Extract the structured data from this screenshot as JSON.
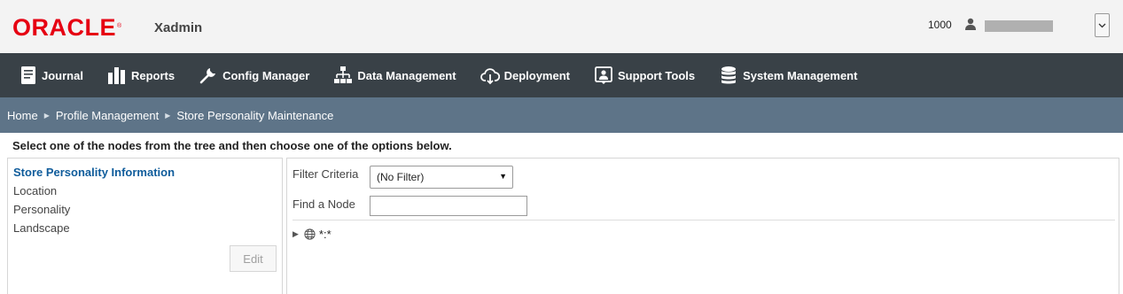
{
  "header": {
    "logo": "ORACLE",
    "logo_mark": "®",
    "app_name": "Xadmin",
    "store_number": "1000"
  },
  "nav": {
    "items": [
      {
        "label": "Journal",
        "icon": "journal-icon"
      },
      {
        "label": "Reports",
        "icon": "reports-icon"
      },
      {
        "label": "Config Manager",
        "icon": "wrench-icon"
      },
      {
        "label": "Data Management",
        "icon": "hierarchy-icon"
      },
      {
        "label": "Deployment",
        "icon": "cloud-download-icon"
      },
      {
        "label": "Support Tools",
        "icon": "support-icon"
      },
      {
        "label": "System Management",
        "icon": "database-icon"
      }
    ]
  },
  "breadcrumb": {
    "items": [
      "Home",
      "Profile Management",
      "Store Personality Maintenance"
    ]
  },
  "instructions": "Select one of the nodes from the tree and then choose one of the options below.",
  "left_panel": {
    "items": [
      "Store Personality Information",
      "Location",
      "Personality",
      "Landscape"
    ],
    "active_index": 0,
    "edit_label": "Edit"
  },
  "right_panel": {
    "filter_label": "Filter Criteria",
    "filter_value": "(No Filter)",
    "find_label": "Find a Node",
    "find_value": "",
    "tree_root": "*:*"
  },
  "colors": {
    "logo_red": "#e60012",
    "nav_bg": "#394147",
    "breadcrumb_bg": "#5e7488",
    "active_link": "#0f5c9b"
  }
}
